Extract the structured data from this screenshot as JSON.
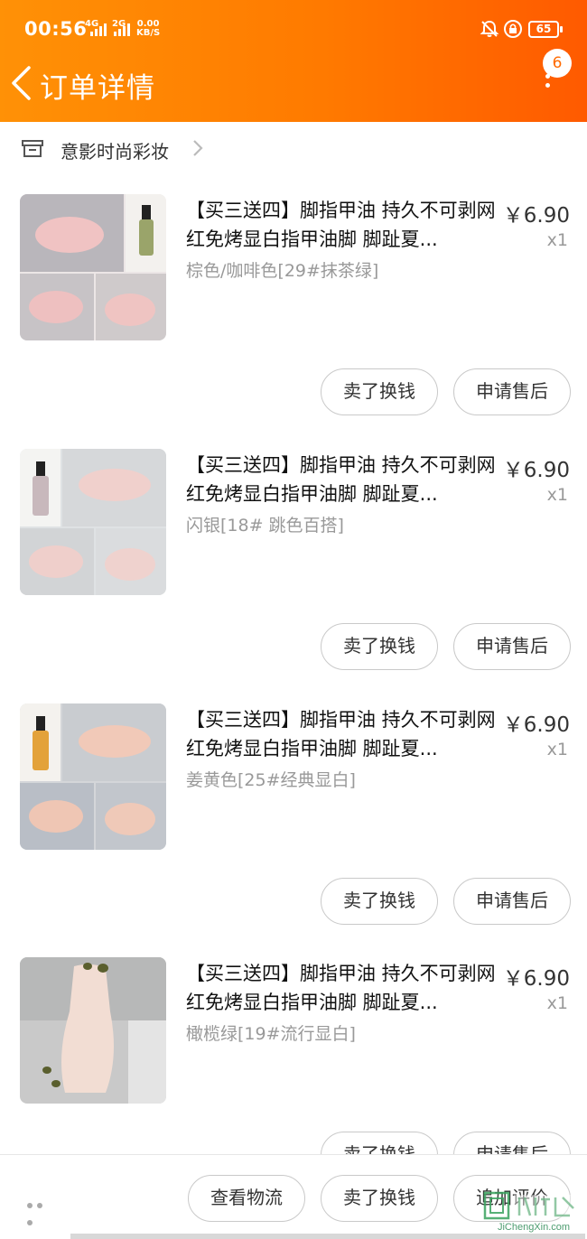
{
  "status_bar": {
    "time": "00:56",
    "net1": "4G",
    "net2": "2G",
    "speed_value": "0.00",
    "speed_unit": "KB/S",
    "battery": "65"
  },
  "header": {
    "title": "订单详情",
    "badge_count": "6"
  },
  "shop": {
    "name": "意影时尚彩妆"
  },
  "items": [
    {
      "title": "【买三送四】脚指甲油 持久不可剥网红免烤显白指甲油脚 脚趾夏...",
      "price": "￥6.90",
      "qty": "x1",
      "sku": "棕色/咖啡色[29#抹茶绿]",
      "btn_sell": "卖了换钱",
      "btn_after_sale": "申请售后",
      "thumb_color": "#9aa46a"
    },
    {
      "title": "【买三送四】脚指甲油 持久不可剥网红免烤显白指甲油脚 脚趾夏...",
      "price": "￥6.90",
      "qty": "x1",
      "sku": "闪银[18# 跳色百搭]",
      "btn_sell": "卖了换钱",
      "btn_after_sale": "申请售后",
      "thumb_color": "#c8b8bc"
    },
    {
      "title": "【买三送四】脚指甲油 持久不可剥网红免烤显白指甲油脚 脚趾夏...",
      "price": "￥6.90",
      "qty": "x1",
      "sku": "姜黄色[25#经典显白]",
      "btn_sell": "卖了换钱",
      "btn_after_sale": "申请售后",
      "thumb_color": "#e3a23a"
    },
    {
      "title": "【买三送四】脚指甲油 持久不可剥网红免烤显白指甲油脚 脚趾夏...",
      "price": "￥6.90",
      "qty": "x1",
      "sku": "橄榄绿[19#流行显白]",
      "btn_sell": "卖了换钱",
      "btn_after_sale": "申请售后",
      "thumb_color": "#5a5f2e"
    }
  ],
  "bottom_bar": {
    "logistics": "查看物流",
    "sell": "卖了换钱",
    "review": "追加评价"
  },
  "watermark": {
    "text": "JiChengXin.com"
  },
  "colors": {
    "header_start": "#ff9106",
    "header_end": "#ff5a00",
    "text_muted": "#999999"
  }
}
